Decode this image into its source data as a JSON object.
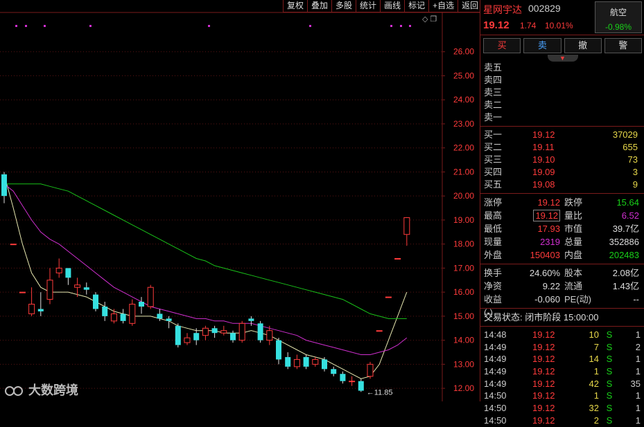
{
  "toolbar": {
    "items": [
      "复权",
      "叠加",
      "多股",
      "统计",
      "画线",
      "标记",
      "+自选",
      "返回"
    ]
  },
  "chart_data": {
    "type": "candlestick",
    "y_ticks": [
      "26.00",
      "25.00",
      "24.00",
      "23.00",
      "22.00",
      "21.00",
      "20.00",
      "19.00",
      "18.00",
      "17.00",
      "16.00",
      "15.00",
      "14.00",
      "13.00",
      "12.00"
    ],
    "ylim": [
      11.6,
      27.0
    ],
    "low_label": "11.85",
    "candles": [
      [
        20.9,
        20.0,
        21.0,
        19.7
      ],
      [
        18.0,
        18.0,
        18.0,
        18.0
      ],
      [
        16.0,
        16.0,
        16.0,
        16.0
      ],
      [
        15.1,
        15.5,
        16.2,
        15.0
      ],
      [
        15.3,
        15.2,
        16.0,
        15.0
      ],
      [
        15.7,
        16.5,
        17.0,
        15.5
      ],
      [
        16.8,
        17.0,
        17.4,
        16.6
      ],
      [
        17.0,
        16.6,
        17.0,
        16.3
      ],
      [
        16.2,
        16.3,
        16.6,
        15.8
      ],
      [
        16.2,
        16.1,
        16.4,
        15.9
      ],
      [
        15.9,
        15.3,
        16.0,
        15.2
      ],
      [
        15.4,
        15.0,
        15.6,
        14.8
      ],
      [
        14.8,
        15.1,
        15.3,
        14.7
      ],
      [
        15.1,
        14.8,
        15.3,
        14.7
      ],
      [
        14.7,
        15.5,
        15.7,
        14.6
      ],
      [
        15.6,
        15.4,
        15.8,
        15.1
      ],
      [
        15.4,
        16.2,
        16.3,
        15.3
      ],
      [
        15.1,
        14.9,
        15.3,
        14.8
      ],
      [
        14.9,
        14.8,
        15.0,
        14.5
      ],
      [
        14.6,
        13.8,
        14.7,
        13.7
      ],
      [
        13.9,
        14.1,
        14.3,
        13.8
      ],
      [
        14.3,
        14.0,
        14.5,
        13.8
      ],
      [
        14.2,
        14.5,
        14.6,
        14.0
      ],
      [
        14.5,
        14.3,
        14.6,
        14.1
      ],
      [
        14.3,
        14.4,
        14.6,
        14.2
      ],
      [
        14.3,
        14.0,
        14.4,
        13.9
      ],
      [
        14.0,
        14.7,
        14.8,
        13.9
      ],
      [
        14.9,
        14.8,
        15.0,
        14.6
      ],
      [
        14.7,
        14.0,
        14.8,
        13.9
      ],
      [
        14.0,
        14.4,
        14.6,
        13.8
      ],
      [
        14.0,
        13.2,
        14.1,
        13.0
      ],
      [
        13.3,
        12.9,
        13.5,
        12.8
      ],
      [
        12.9,
        13.2,
        13.4,
        12.8
      ],
      [
        13.3,
        12.9,
        13.4,
        12.8
      ],
      [
        13.0,
        13.2,
        13.3,
        12.9
      ],
      [
        13.2,
        12.8,
        13.3,
        12.7
      ],
      [
        12.8,
        12.6,
        12.9,
        12.5
      ],
      [
        12.6,
        12.3,
        12.7,
        12.2
      ],
      [
        12.3,
        12.3,
        12.5,
        12.1
      ],
      [
        12.3,
        11.9,
        12.4,
        11.85
      ],
      [
        12.5,
        13.0,
        13.1,
        12.4
      ],
      [
        14.4,
        14.4,
        14.4,
        14.4
      ],
      [
        15.8,
        15.8,
        15.8,
        15.8
      ],
      [
        17.4,
        17.4,
        17.4,
        17.4
      ],
      [
        18.4,
        19.1,
        19.12,
        17.93
      ]
    ],
    "ma_lines": [
      {
        "color": "#e8e8b0",
        "values": [
          20.9,
          19.5,
          18.0,
          16.8,
          16.2,
          16.0,
          16.0,
          16.0,
          15.9,
          15.8,
          15.6,
          15.4,
          15.2,
          15.1,
          15.0,
          15.0,
          15.0,
          14.9,
          14.8,
          14.6,
          14.5,
          14.4,
          14.4,
          14.4,
          14.3,
          14.3,
          14.3,
          14.4,
          14.3,
          14.2,
          14.0,
          13.8,
          13.6,
          13.4,
          13.3,
          13.2,
          13.0,
          12.8,
          12.6,
          12.4,
          12.5,
          13.0,
          14.0,
          15.0,
          16.0
        ]
      },
      {
        "color": "#d02fd0",
        "values": [
          20.5,
          20.2,
          19.6,
          19.0,
          18.5,
          18.2,
          18.0,
          17.7,
          17.4,
          17.1,
          16.8,
          16.5,
          16.2,
          16.0,
          15.8,
          15.6,
          15.4,
          15.3,
          15.2,
          15.1,
          15.0,
          14.9,
          14.9,
          14.8,
          14.8,
          14.7,
          14.7,
          14.7,
          14.6,
          14.5,
          14.4,
          14.3,
          14.2,
          14.0,
          13.9,
          13.8,
          13.7,
          13.6,
          13.5,
          13.4,
          13.4,
          13.5,
          13.6,
          13.8,
          14.1
        ]
      },
      {
        "color": "#19c119",
        "values": [
          20.5,
          20.5,
          20.5,
          20.5,
          20.5,
          20.4,
          20.3,
          20.2,
          20.0,
          19.8,
          19.6,
          19.4,
          19.2,
          19.0,
          18.8,
          18.6,
          18.4,
          18.2,
          18.0,
          17.8,
          17.6,
          17.4,
          17.3,
          17.1,
          17.0,
          16.9,
          16.8,
          16.7,
          16.6,
          16.5,
          16.4,
          16.3,
          16.2,
          16.1,
          16.0,
          15.9,
          15.8,
          15.7,
          15.5,
          15.3,
          15.1,
          15.0,
          14.9,
          14.9,
          14.9
        ]
      }
    ]
  },
  "panel": {
    "name": "星网宇达",
    "code": "002829",
    "sector_name": "航空",
    "sector_change": "-0.98%",
    "price": "19.12",
    "change": "1.74",
    "change_pct": "10.01%",
    "buttons": {
      "buy": "买",
      "sell": "卖",
      "cancel": "撤",
      "alert": "警"
    },
    "asks": [
      {
        "label": "卖五",
        "price": "",
        "vol": ""
      },
      {
        "label": "卖四",
        "price": "",
        "vol": ""
      },
      {
        "label": "卖三",
        "price": "",
        "vol": ""
      },
      {
        "label": "卖二",
        "price": "",
        "vol": ""
      },
      {
        "label": "卖一",
        "price": "",
        "vol": ""
      }
    ],
    "bids": [
      {
        "label": "买一",
        "price": "19.12",
        "vol": "37029"
      },
      {
        "label": "买二",
        "price": "19.11",
        "vol": "655"
      },
      {
        "label": "买三",
        "price": "19.10",
        "vol": "73"
      },
      {
        "label": "买四",
        "price": "19.09",
        "vol": "3"
      },
      {
        "label": "买五",
        "price": "19.08",
        "vol": "9"
      }
    ],
    "stats": [
      {
        "l1": "涨停",
        "v1": "19.12",
        "c1": "red",
        "l2": "跌停",
        "v2": "15.64",
        "c2": "green"
      },
      {
        "l1": "最高",
        "v1": "19.12",
        "c1": "red boxed",
        "l2": "量比",
        "v2": "6.52",
        "c2": "purple"
      },
      {
        "l1": "最低",
        "v1": "17.93",
        "c1": "red",
        "l2": "市值",
        "v2": "39.7亿",
        "c2": "white"
      },
      {
        "l1": "现量",
        "v1": "2319",
        "c1": "purple",
        "l2": "总量",
        "v2": "352886",
        "c2": "white"
      },
      {
        "l1": "外盘",
        "v1": "150403",
        "c1": "red",
        "l2": "内盘",
        "v2": "202483",
        "c2": "green"
      }
    ],
    "stats2": [
      {
        "l1": "换手",
        "v1": "24.60%",
        "c1": "white",
        "l2": "股本",
        "v2": "2.08亿",
        "c2": "white"
      },
      {
        "l1": "净资",
        "v1": "9.22",
        "c1": "white",
        "l2": "流通",
        "v2": "1.43亿",
        "c2": "white"
      },
      {
        "l1": "收益(-)",
        "v1": "-0.060",
        "c1": "white",
        "l2": "PE(动)",
        "v2": "--",
        "c2": "white"
      }
    ],
    "status_label": "交易状态:",
    "status_value": "闭市阶段 15:00:00",
    "ticks": [
      {
        "time": "14:48",
        "price": "19.12",
        "vol": "10",
        "side": "S",
        "num": "1"
      },
      {
        "time": "14:49",
        "price": "19.12",
        "vol": "7",
        "side": "S",
        "num": "2"
      },
      {
        "time": "14:49",
        "price": "19.12",
        "vol": "14",
        "side": "S",
        "num": "1"
      },
      {
        "time": "14:49",
        "price": "19.12",
        "vol": "1",
        "side": "S",
        "num": "1"
      },
      {
        "time": "14:49",
        "price": "19.12",
        "vol": "42",
        "side": "S",
        "num": "35"
      },
      {
        "time": "14:50",
        "price": "19.12",
        "vol": "1",
        "side": "S",
        "num": "1"
      },
      {
        "time": "14:50",
        "price": "19.12",
        "vol": "32",
        "side": "S",
        "num": "1"
      },
      {
        "time": "14:50",
        "price": "19.12",
        "vol": "2",
        "side": "S",
        "num": "1"
      }
    ]
  },
  "watermark": "大数跨境"
}
